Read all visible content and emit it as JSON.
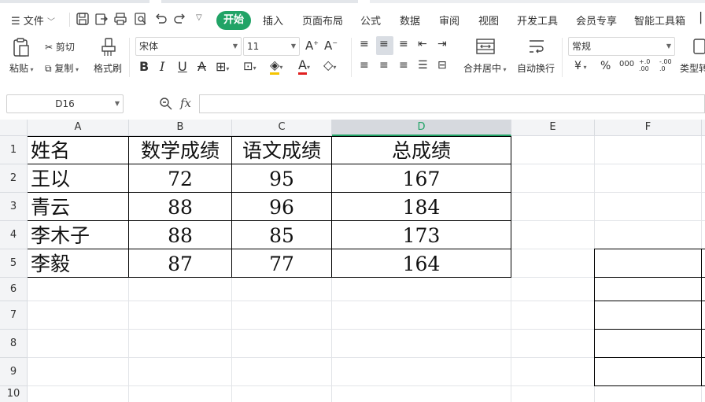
{
  "menu": {
    "file_label": "文件",
    "tabs": [
      "开始",
      "插入",
      "页面布局",
      "公式",
      "数据",
      "审阅",
      "视图",
      "开发工具",
      "会员专享",
      "智能工具箱"
    ],
    "active_tab": "开始",
    "accent_color": "#21a366"
  },
  "ribbon": {
    "paste_label": "粘贴",
    "cut_label": "剪切",
    "copy_label": "复制",
    "format_painter_label": "格式刷",
    "font_name": "宋体",
    "font_size": "11",
    "merge_label": "合并居中",
    "wrap_label": "自动换行",
    "number_format": "常规",
    "type_convert_label": "类型转",
    "currency_symbol": "¥",
    "percent_symbol": "%",
    "thousands_symbol": "000",
    "increase_decimal": "+.0 .00",
    "decrease_decimal": "-.00 .0"
  },
  "formula_bar": {
    "cell_ref": "D16",
    "fx_label": "fx",
    "formula": ""
  },
  "sheet": {
    "columns": [
      "A",
      "B",
      "C",
      "D",
      "E",
      "F"
    ],
    "selected_column": "D",
    "rows": [
      "1",
      "2",
      "3",
      "4",
      "5",
      "6",
      "7",
      "8",
      "9",
      "10"
    ],
    "table": {
      "headers": [
        "姓名",
        "数学成绩",
        "语文成绩",
        "总成绩"
      ],
      "data": [
        [
          "王以",
          "72",
          "95",
          "167"
        ],
        [
          "青云",
          "88",
          "96",
          "184"
        ],
        [
          "李木子",
          "88",
          "85",
          "173"
        ],
        [
          "李毅",
          "87",
          "77",
          "164"
        ]
      ]
    }
  }
}
